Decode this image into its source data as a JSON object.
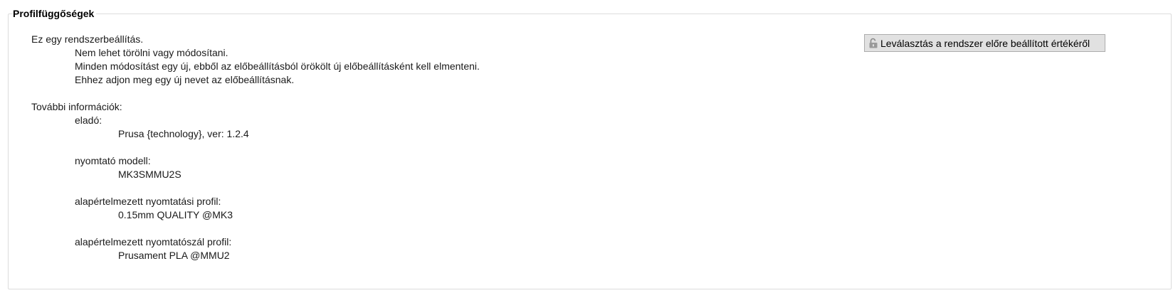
{
  "group": {
    "title": "Profilfüggőségek"
  },
  "system_info": {
    "heading": "Ez egy rendszerbeállítás.",
    "lines": [
      "Nem lehet törölni vagy módosítani.",
      "Minden módosítást egy új, ebből az előbeállításból örökölt új előbeállításként kell elmenteni.",
      "Ehhez adjon meg egy új nevet az előbeállításnak."
    ]
  },
  "more_info": {
    "heading": "További információk:",
    "vendor_label": "eladó:",
    "vendor_value": "Prusa {technology}, ver: 1.2.4",
    "printer_model_label": "nyomtató modell:",
    "printer_model_value": "MK3SMMU2S",
    "default_print_profile_label": "alapértelmezett nyomtatási profil:",
    "default_print_profile_value": "0.15mm QUALITY @MK3",
    "default_filament_profile_label": "alapértelmezett nyomtatószál profil:",
    "default_filament_profile_value": "Prusament PLA @MMU2"
  },
  "detach_button": {
    "label": "Leválasztás a rendszer előre beállított értékéről",
    "icon": "unlock-icon"
  }
}
